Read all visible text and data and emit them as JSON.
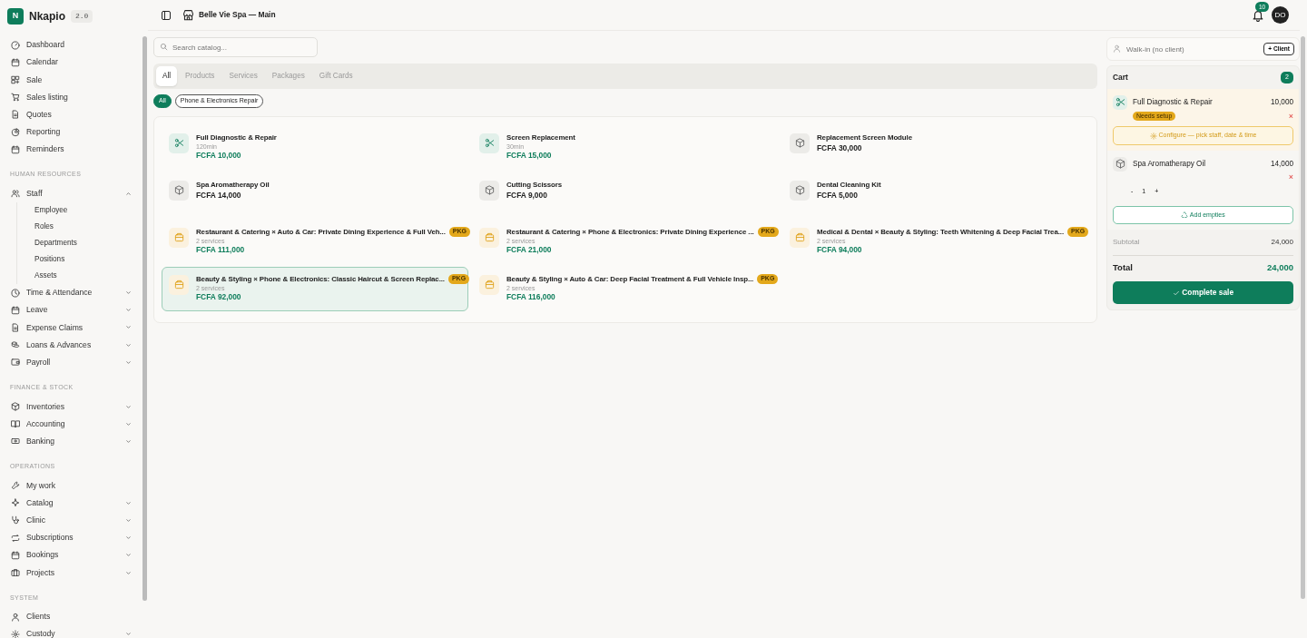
{
  "app": {
    "name": "Nkapio",
    "version": "2.0",
    "logo_letter": "N"
  },
  "header": {
    "location": "Belle Vie Spa — Main",
    "notifications": "10",
    "avatar": "DO"
  },
  "sidebar": [
    {
      "kind": "item",
      "label": "Dashboard"
    },
    {
      "kind": "item",
      "label": "Calendar"
    },
    {
      "kind": "item",
      "label": "Sale"
    },
    {
      "kind": "item",
      "label": "Sales listing"
    },
    {
      "kind": "item",
      "label": "Quotes"
    },
    {
      "kind": "item",
      "label": "Reporting"
    },
    {
      "kind": "item",
      "label": "Reminders"
    },
    {
      "kind": "section",
      "label": "HUMAN RESOURCES"
    },
    {
      "kind": "item",
      "label": "Staff",
      "expanded": true,
      "children": [
        {
          "label": "Employee"
        },
        {
          "label": "Roles"
        },
        {
          "label": "Departments"
        },
        {
          "label": "Positions"
        },
        {
          "label": "Assets"
        }
      ]
    },
    {
      "kind": "item",
      "label": "Time & Attendance",
      "expanded": false
    },
    {
      "kind": "item",
      "label": "Leave",
      "expanded": false
    },
    {
      "kind": "item",
      "label": "Expense Claims",
      "expanded": false
    },
    {
      "kind": "item",
      "label": "Loans & Advances",
      "expanded": false
    },
    {
      "kind": "item",
      "label": "Payroll",
      "expanded": false
    },
    {
      "kind": "section",
      "label": "FINANCE & STOCK"
    },
    {
      "kind": "item",
      "label": "Inventories",
      "expanded": false
    },
    {
      "kind": "item",
      "label": "Accounting",
      "expanded": false
    },
    {
      "kind": "item",
      "label": "Banking",
      "expanded": false
    },
    {
      "kind": "section",
      "label": "OPERATIONS"
    },
    {
      "kind": "item",
      "label": "My work"
    },
    {
      "kind": "item",
      "label": "Catalog",
      "expanded": false
    },
    {
      "kind": "item",
      "label": "Clinic",
      "expanded": false
    },
    {
      "kind": "item",
      "label": "Subscriptions",
      "expanded": false
    },
    {
      "kind": "item",
      "label": "Bookings",
      "expanded": false
    },
    {
      "kind": "item",
      "label": "Projects",
      "expanded": false
    },
    {
      "kind": "section",
      "label": "SYSTEM"
    },
    {
      "kind": "item",
      "label": "Clients"
    },
    {
      "kind": "item",
      "label": "Custody",
      "expanded": false
    }
  ],
  "search": {
    "placeholder": "Search catalog..."
  },
  "tabs": [
    {
      "label": "All",
      "selected": true
    },
    {
      "label": "Products",
      "selected": false
    },
    {
      "label": "Services",
      "selected": false
    },
    {
      "label": "Packages",
      "selected": false
    },
    {
      "label": "Gift Cards",
      "selected": false
    }
  ],
  "filters": [
    {
      "label": "All",
      "selected": true
    },
    {
      "label": "Phone & Electronics Repair",
      "selected": false
    }
  ],
  "catalog": [
    {
      "kind": "service",
      "name": "Full Diagnostic & Repair",
      "meta": "120min",
      "price": "FCFA 10,000",
      "selected": false
    },
    {
      "kind": "service",
      "name": "Screen Replacement",
      "meta": "30min",
      "price": "FCFA 15,000",
      "selected": false
    },
    {
      "kind": "product",
      "name": "Replacement Screen Module",
      "price": "FCFA 30,000",
      "selected": false
    },
    {
      "kind": "product",
      "name": "Spa Aromatherapy Oil",
      "price": "FCFA 14,000",
      "selected": false
    },
    {
      "kind": "product",
      "name": "Cutting Scissors",
      "price": "FCFA 9,000",
      "selected": false
    },
    {
      "kind": "product",
      "name": "Dental Cleaning Kit",
      "price": "FCFA 5,000",
      "selected": false
    },
    {
      "kind": "package",
      "name": "Restaurant & Catering × Auto & Car: Private Dining Experience & Full Veh...",
      "badge": "PKG",
      "meta": "2 services",
      "price": "FCFA 111,000",
      "selected": false
    },
    {
      "kind": "package",
      "name": "Restaurant & Catering × Phone & Electronics: Private Dining Experience ...",
      "badge": "PKG",
      "meta": "2 services",
      "price": "FCFA 21,000",
      "selected": false
    },
    {
      "kind": "package",
      "name": "Medical & Dental × Beauty & Styling: Teeth Whitening & Deep Facial Trea...",
      "badge": "PKG",
      "meta": "2 services",
      "price": "FCFA 94,000",
      "selected": false
    },
    {
      "kind": "package",
      "name": "Beauty & Styling × Phone & Electronics: Classic Haircut & Screen Replac...",
      "badge": "PKG",
      "meta": "2 services",
      "price": "FCFA 92,000",
      "selected": true
    },
    {
      "kind": "package",
      "name": "Beauty & Styling × Auto & Car: Deep Facial Treatment & Full Vehicle Insp...",
      "badge": "PKG",
      "meta": "2 services",
      "price": "FCFA 116,000",
      "selected": false
    }
  ],
  "client": {
    "placeholder": "Walk-in (no client)",
    "button": "+ Client"
  },
  "cart": {
    "title": "Cart",
    "count": "2",
    "items": [
      {
        "kind": "service",
        "name": "Full Diagnostic & Repair",
        "amount": "10,000",
        "remove": "×",
        "status": "Needs setup",
        "action": "Configure — pick staff, date & time"
      },
      {
        "kind": "product",
        "name": "Spa Aromatherapy Oil",
        "amount": "14,000",
        "remove": "×",
        "minus": "-",
        "qty": "1",
        "plus": "+",
        "action": "Add empties"
      }
    ],
    "subtotal_label": "Subtotal",
    "subtotal": "24,000",
    "total_label": "Total",
    "total": "24,000",
    "checkout": "Complete sale"
  }
}
